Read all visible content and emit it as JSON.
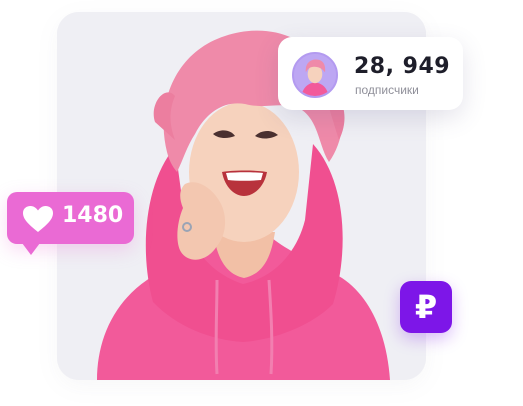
{
  "colors": {
    "card_background": "#efeff4",
    "hoodie_pink": "#f25a9a",
    "hair_pink": "#ef8aa9",
    "likes_bubble": "#ea6ad4",
    "ruble_badge": "#7d16e8",
    "avatar_background": "#bda7f3"
  },
  "photo": {
    "icon": "smiling-woman-pink-hoodie"
  },
  "subscribers_card": {
    "count": "28, 949",
    "label": "подписчики",
    "avatar_icon": "woman-avatar"
  },
  "likes": {
    "count": "1480",
    "icon": "heart-icon"
  },
  "currency_badge": {
    "symbol": "₽",
    "icon": "ruble-icon"
  }
}
